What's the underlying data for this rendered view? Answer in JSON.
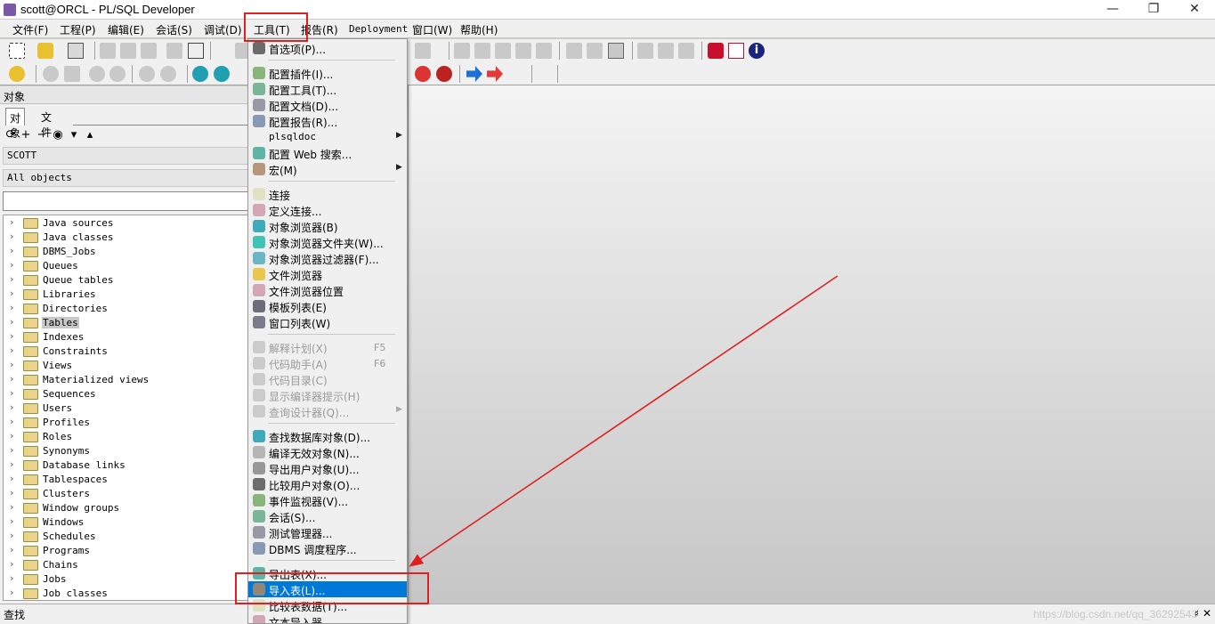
{
  "window": {
    "title": "scott@ORCL - PL/SQL Developer"
  },
  "menubar": [
    {
      "id": "file",
      "label": "文件(F)"
    },
    {
      "id": "project",
      "label": "工程(P)"
    },
    {
      "id": "edit",
      "label": "编辑(E)"
    },
    {
      "id": "session",
      "label": "会话(S)"
    },
    {
      "id": "debug",
      "label": "调试(D)"
    },
    {
      "id": "tools",
      "label": "工具(T)"
    },
    {
      "id": "reports",
      "label": "报告(R)"
    },
    {
      "id": "deployment",
      "label": "Deployment"
    },
    {
      "id": "window",
      "label": "窗口(W)"
    },
    {
      "id": "help",
      "label": "帮助(H)"
    }
  ],
  "left_panel": {
    "header": "对象",
    "tabs": [
      {
        "label": "对象",
        "active": true
      },
      {
        "label": "文件",
        "active": false
      }
    ],
    "user_combo": "SCOTT",
    "scope_combo": "All objects",
    "filter_value": "",
    "tree": [
      {
        "label": "Java sources"
      },
      {
        "label": "Java classes"
      },
      {
        "label": "DBMS_Jobs"
      },
      {
        "label": "Queues"
      },
      {
        "label": "Queue tables"
      },
      {
        "label": "Libraries"
      },
      {
        "label": "Directories"
      },
      {
        "label": "Tables",
        "selected": true
      },
      {
        "label": "Indexes"
      },
      {
        "label": "Constraints"
      },
      {
        "label": "Views"
      },
      {
        "label": "Materialized views"
      },
      {
        "label": "Sequences"
      },
      {
        "label": "Users"
      },
      {
        "label": "Profiles"
      },
      {
        "label": "Roles"
      },
      {
        "label": "Synonyms"
      },
      {
        "label": "Database links"
      },
      {
        "label": "Tablespaces"
      },
      {
        "label": "Clusters"
      },
      {
        "label": "Window groups"
      },
      {
        "label": "Windows"
      },
      {
        "label": "Schedules"
      },
      {
        "label": "Programs"
      },
      {
        "label": "Chains"
      },
      {
        "label": "Jobs"
      },
      {
        "label": "Job classes"
      }
    ],
    "find_label": "查找"
  },
  "tools_menu": {
    "items": [
      {
        "label": "首选项(P)...",
        "icon": "wrench-icon"
      },
      {
        "separator": true
      },
      {
        "label": "配置插件(I)...",
        "icon": "plugin-icon"
      },
      {
        "label": "配置工具(T)...",
        "icon": "tools-config-icon"
      },
      {
        "label": "配置文档(D)...",
        "icon": "document-config-icon"
      },
      {
        "label": "配置报告(R)...",
        "icon": "report-config-icon"
      },
      {
        "label": "plsqldoc",
        "submenu": true
      },
      {
        "label": "配置 Web 搜索...",
        "icon": "web-search-icon"
      },
      {
        "label": "宏(M)",
        "icon": "macro-icon",
        "submenu": true
      },
      {
        "separator": true
      },
      {
        "label": "连接",
        "icon": "connect-icon"
      },
      {
        "label": "定义连接...",
        "icon": "define-connection-icon"
      },
      {
        "label": "对象浏览器(B)",
        "icon": "object-browser-icon"
      },
      {
        "label": "对象浏览器文件夹(W)...",
        "icon": "browser-folders-icon"
      },
      {
        "label": "对象浏览器过滤器(F)...",
        "icon": "browser-filters-icon"
      },
      {
        "label": "文件浏览器",
        "icon": "file-browser-icon"
      },
      {
        "label": "文件浏览器位置",
        "icon": "file-browser-location-icon"
      },
      {
        "label": "模板列表(E)",
        "icon": "template-list-icon"
      },
      {
        "label": "窗口列表(W)",
        "icon": "window-list-icon"
      },
      {
        "separator": true
      },
      {
        "label": "解释计划(X)",
        "shortcut": "F5",
        "disabled": true,
        "icon": "explain-plan-icon"
      },
      {
        "label": "代码助手(A)",
        "shortcut": "F6",
        "disabled": true,
        "icon": "code-assistant-icon"
      },
      {
        "label": "代码目录(C)",
        "disabled": true,
        "icon": "code-contents-icon"
      },
      {
        "label": "显示编译器提示(H)",
        "disabled": true,
        "icon": "compiler-hints-icon"
      },
      {
        "label": "查询设计器(Q)...",
        "disabled": true,
        "icon": "query-designer-icon",
        "submenu": true
      },
      {
        "separator": true
      },
      {
        "label": "查找数据库对象(D)...",
        "icon": "find-db-objects-icon"
      },
      {
        "label": "编译无效对象(N)...",
        "icon": "compile-invalid-icon"
      },
      {
        "label": "导出用户对象(U)...",
        "icon": "export-user-objects-icon"
      },
      {
        "label": "比较用户对象(O)...",
        "icon": "compare-user-objects-icon"
      },
      {
        "label": "事件监视器(V)...",
        "icon": "event-monitor-icon"
      },
      {
        "label": "会话(S)...",
        "icon": "sessions-icon"
      },
      {
        "label": "测试管理器...",
        "icon": "test-manager-icon"
      },
      {
        "label": "DBMS 调度程序...",
        "icon": "dbms-scheduler-icon"
      },
      {
        "separator": true
      },
      {
        "label": "导出表(X)...",
        "icon": "export-tables-icon"
      },
      {
        "label": "导入表(L)...",
        "icon": "import-tables-icon",
        "highlighted": true
      },
      {
        "label": "比较表数据(T)...",
        "icon": "compare-table-data-icon"
      },
      {
        "label": "文本导入器",
        "icon": "text-importer-icon"
      }
    ]
  },
  "watermark": "https://blog.csdn.net/qq_36292543",
  "colors": {
    "highlight": "#0078d7",
    "annotation": "#e02020"
  }
}
